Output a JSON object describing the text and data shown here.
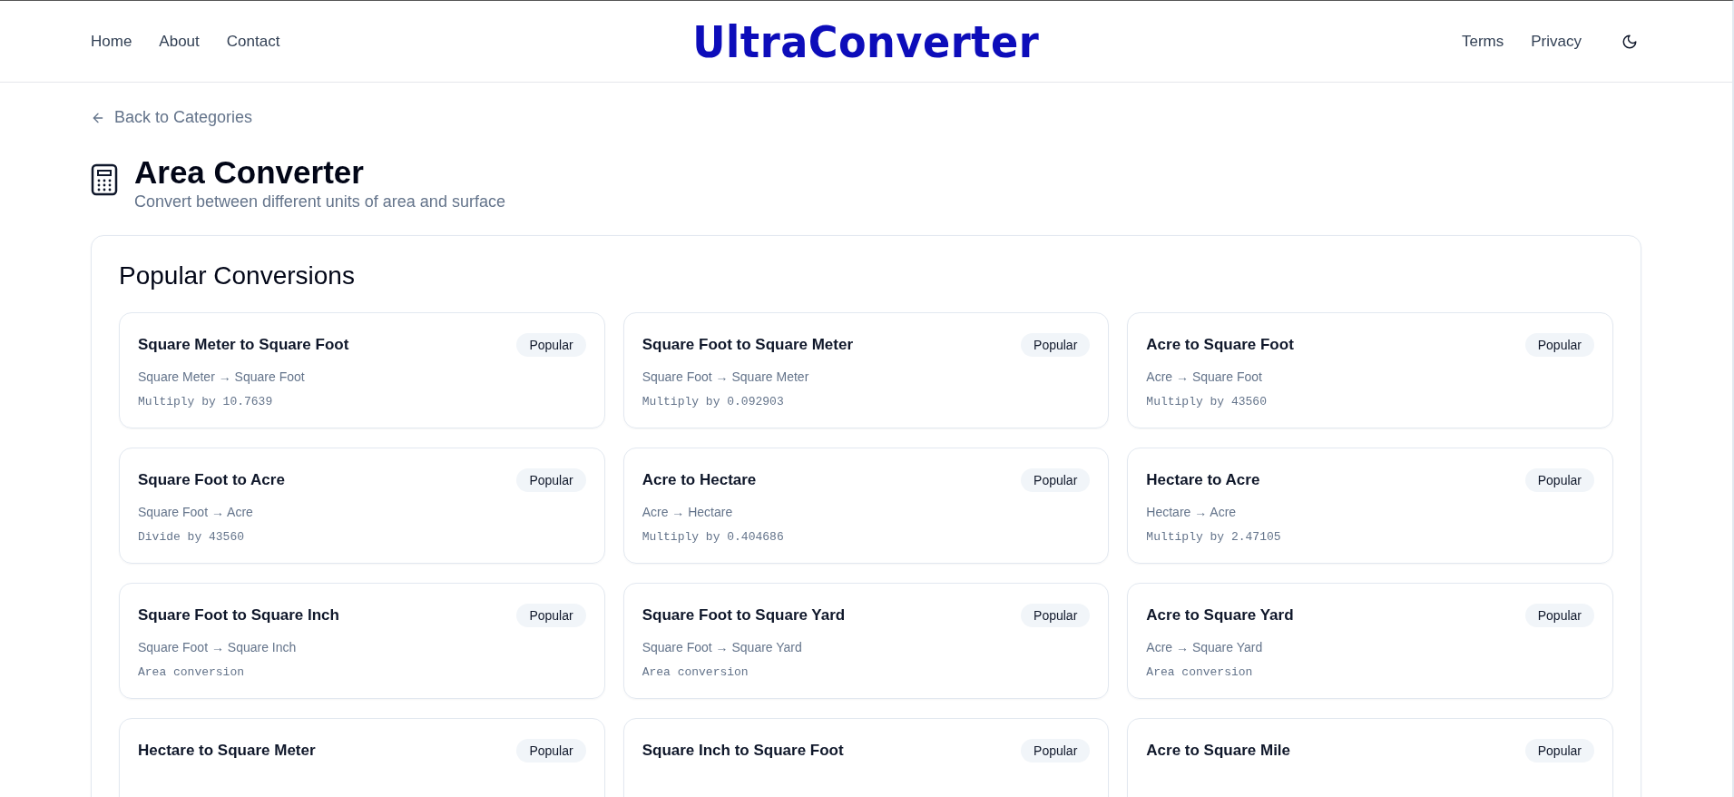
{
  "header": {
    "nav_left": [
      "Home",
      "About",
      "Contact"
    ],
    "logo": "UltraConverter",
    "nav_right": [
      "Terms",
      "Privacy"
    ]
  },
  "back_link": "Back to Categories",
  "page": {
    "title": "Area Converter",
    "subtitle": "Convert between different units of area and surface"
  },
  "popular": {
    "heading": "Popular Conversions",
    "cards": [
      {
        "title": "Square Meter to Square Foot",
        "badge": "Popular",
        "units": "Square Meter → Square Foot",
        "formula": "Multiply by 10.7639"
      },
      {
        "title": "Square Foot to Square Meter",
        "badge": "Popular",
        "units": "Square Foot → Square Meter",
        "formula": "Multiply by 0.092903"
      },
      {
        "title": "Acre to Square Foot",
        "badge": "Popular",
        "units": "Acre → Square Foot",
        "formula": "Multiply by 43560"
      },
      {
        "title": "Square Foot to Acre",
        "badge": "Popular",
        "units": "Square Foot → Acre",
        "formula": "Divide by 43560"
      },
      {
        "title": "Acre to Hectare",
        "badge": "Popular",
        "units": "Acre → Hectare",
        "formula": "Multiply by 0.404686"
      },
      {
        "title": "Hectare to Acre",
        "badge": "Popular",
        "units": "Hectare → Acre",
        "formula": "Multiply by 2.47105"
      },
      {
        "title": "Square Foot to Square Inch",
        "badge": "Popular",
        "units": "Square Foot → Square Inch",
        "formula": "Area conversion"
      },
      {
        "title": "Square Foot to Square Yard",
        "badge": "Popular",
        "units": "Square Foot → Square Yard",
        "formula": "Area conversion"
      },
      {
        "title": "Acre to Square Yard",
        "badge": "Popular",
        "units": "Acre → Square Yard",
        "formula": "Area conversion"
      },
      {
        "title": "Hectare to Square Meter",
        "badge": "Popular"
      },
      {
        "title": "Square Inch to Square Foot",
        "badge": "Popular"
      },
      {
        "title": "Acre to Square Mile",
        "badge": "Popular"
      }
    ]
  }
}
